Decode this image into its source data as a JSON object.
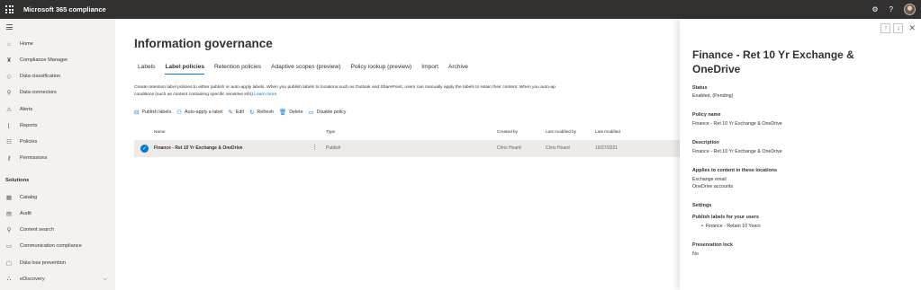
{
  "topbar": {
    "app_title": "Microsoft 365 compliance",
    "icons": [
      "settings-icon",
      "help-icon",
      "avatar"
    ],
    "settings_glyph": "⚙",
    "help_glyph": "?"
  },
  "sidebar": {
    "items": [
      {
        "label": "Home",
        "icon": "home-icon",
        "glyph": "⌂"
      },
      {
        "label": "Compliance Manager",
        "icon": "trophy-icon",
        "glyph": "♜"
      },
      {
        "label": "Data classification",
        "icon": "tag-icon",
        "glyph": "◇"
      },
      {
        "label": "Data connectors",
        "icon": "plug-icon",
        "glyph": "⚲"
      },
      {
        "label": "Alerts",
        "icon": "warning-icon",
        "glyph": "⚠"
      },
      {
        "label": "Reports",
        "icon": "chart-icon",
        "glyph": "⌊"
      },
      {
        "label": "Policies",
        "icon": "policies-icon",
        "glyph": "☷"
      },
      {
        "label": "Permissions",
        "icon": "key-icon",
        "glyph": "⚷"
      }
    ],
    "solutions_heading": "Solutions",
    "solution_items": [
      {
        "label": "Catalog",
        "icon": "catalog-icon",
        "glyph": "▦"
      },
      {
        "label": "Audit",
        "icon": "audit-icon",
        "glyph": "▤"
      },
      {
        "label": "Content search",
        "icon": "search-icon",
        "glyph": "⚲"
      },
      {
        "label": "Communication compliance",
        "icon": "chat-icon",
        "glyph": "▭"
      },
      {
        "label": "Data loss prevention",
        "icon": "shield-icon",
        "glyph": "▢"
      },
      {
        "label": "eDiscovery",
        "icon": "briefcase-icon",
        "glyph": "⛬"
      }
    ],
    "chevron": "⌵"
  },
  "main": {
    "page_title": "Information governance",
    "tabs": [
      "Labels",
      "Label policies",
      "Retention policies",
      "Adaptive scopes (preview)",
      "Policy lookup (preview)",
      "Import",
      "Archive"
    ],
    "active_tab": "Label policies",
    "description": "Create retention label policies to either publish or auto-apply labels. When you publish labels to locations such as Outlook and SharePoint, users can manually apply the labels to retain their content. When you auto-ap",
    "description_line2": "conditions (such as content containing specific sensitive info).",
    "learn_more": "Learn more",
    "toolbar": [
      {
        "label": "Publish labels",
        "icon": "publish-icon",
        "glyph": "⊟"
      },
      {
        "label": "Auto-apply a label",
        "icon": "auto-apply-icon",
        "glyph": "⚇"
      },
      {
        "label": "Edit",
        "icon": "edit-icon",
        "glyph": "✎"
      },
      {
        "label": "Refresh",
        "icon": "refresh-icon",
        "glyph": "↻"
      },
      {
        "label": "Delete",
        "icon": "delete-icon",
        "glyph": "🗑"
      },
      {
        "label": "Disable policy",
        "icon": "disable-icon",
        "glyph": "▭"
      }
    ],
    "table": {
      "columns": [
        "Name",
        "Type",
        "Created by",
        "Last modified by",
        "Last modified"
      ],
      "rows": [
        {
          "name": "Finance - Ret 10 Yr Exchange & OneDrive",
          "type": "Publish",
          "created_by": "Chris Hoard",
          "last_modified_by": "Chris Hoard",
          "last_modified": "10/27/2021",
          "selected": true
        }
      ]
    }
  },
  "panel": {
    "title": "Finance - Ret 10 Yr Exchange & OneDrive",
    "up_glyph": "↑",
    "down_glyph": "↓",
    "close_glyph": "✕",
    "status_label": "Status",
    "status_value": "Enabled, (Pending)",
    "policy_name_label": "Policy name",
    "policy_name_value": "Finance - Ret 10 Yr Exchange & OneDrive",
    "description_label": "Description",
    "description_value": "Finance - Ret 10 Yr Exchange & OneDrive",
    "locations_label": "Applies to content in these locations",
    "locations": [
      "Exchange email",
      "OneDrive accounts"
    ],
    "settings_label": "Settings",
    "publish_labels_label": "Publish labels for your users",
    "published_labels": [
      "Finance - Retain 10 Years"
    ],
    "preservation_lock_label": "Preservation lock",
    "preservation_lock_value": "No"
  },
  "colors": {
    "accent": "#0078d4",
    "topbar": "#323130",
    "nav_bg": "#f3f2f1",
    "selected_row": "#edebe9"
  }
}
